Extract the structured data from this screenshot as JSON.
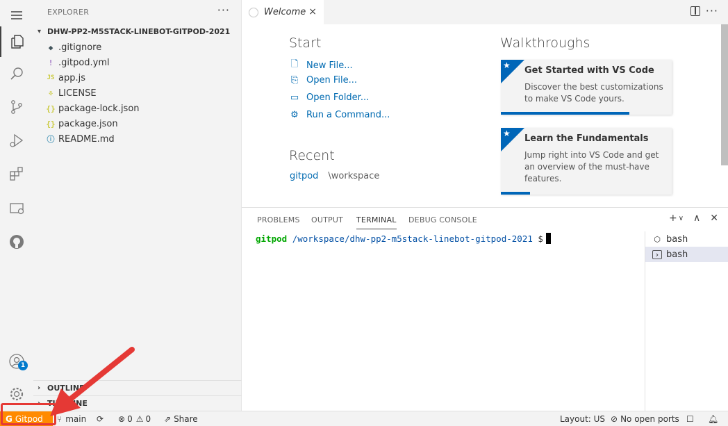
{
  "activity_bar": {
    "icons": [
      "menu-icon",
      "files-icon",
      "search-icon",
      "source-control-icon",
      "run-debug-icon",
      "extensions-icon",
      "remote-explorer-icon",
      "github-icon",
      "accounts-icon",
      "settings-gear-icon"
    ],
    "accounts_badge": "1"
  },
  "sidebar": {
    "header": "EXPLORER",
    "more": "···",
    "folder": "DHW-PP2-M5STACK-LINEBOT-GITPOD-2021",
    "files": [
      {
        "name": ".gitignore",
        "icon": "◆",
        "color": "#41535b"
      },
      {
        "name": ".gitpod.yml",
        "icon": "!",
        "color": "#a074c4"
      },
      {
        "name": "app.js",
        "icon": "JS",
        "color": "#cbcb41"
      },
      {
        "name": "LICENSE",
        "icon": "⚘",
        "color": "#cbcb41"
      },
      {
        "name": "package-lock.json",
        "icon": "{}",
        "color": "#cbcb41"
      },
      {
        "name": "package.json",
        "icon": "{}",
        "color": "#cbcb41"
      },
      {
        "name": "README.md",
        "icon": "ⓘ",
        "color": "#519aba"
      }
    ],
    "outline": "OUTLINE",
    "timeline": "TIMELINE"
  },
  "editor": {
    "tab_label": "Welcome",
    "tab_close": "×",
    "more": "···"
  },
  "welcome": {
    "start_heading": "Start",
    "links": [
      {
        "label": "New File...",
        "icon": "new-file-icon"
      },
      {
        "label": "Open File...",
        "icon": "open-file-icon"
      },
      {
        "label": "Open Folder...",
        "icon": "open-folder-icon"
      },
      {
        "label": "Run a Command...",
        "icon": "run-command-icon"
      }
    ],
    "recent_heading": "Recent",
    "recent": [
      {
        "name": "gitpod",
        "path": "\\workspace"
      }
    ],
    "walkthroughs_heading": "Walkthroughs",
    "cards": [
      {
        "title": "Get Started with VS Code",
        "desc": "Discover the best customizations to make VS Code yours.",
        "progress": 0.75
      },
      {
        "title": "Learn the Fundamentals",
        "desc": "Jump right into VS Code and get an overview of the must-have features.",
        "progress": 0.17
      }
    ]
  },
  "panel": {
    "tabs": [
      "PROBLEMS",
      "OUTPUT",
      "TERMINAL",
      "DEBUG CONSOLE"
    ],
    "active_tab": "TERMINAL",
    "prompt_user": "gitpod",
    "prompt_path": "/workspace/dhw-pp2-m5stack-linebot-gitpod-2021",
    "prompt_symbol": "$",
    "terminals": [
      "bash",
      "bash"
    ]
  },
  "status_bar": {
    "gitpod": "Gitpod",
    "branch": "main",
    "errors": "0",
    "warnings": "0",
    "share": "Share",
    "layout": "Layout: US",
    "ports": "No open ports"
  },
  "colors": {
    "accent": "#0066b8",
    "gitpod_orange": "#ff8a00",
    "annotation_red": "#e53935"
  }
}
